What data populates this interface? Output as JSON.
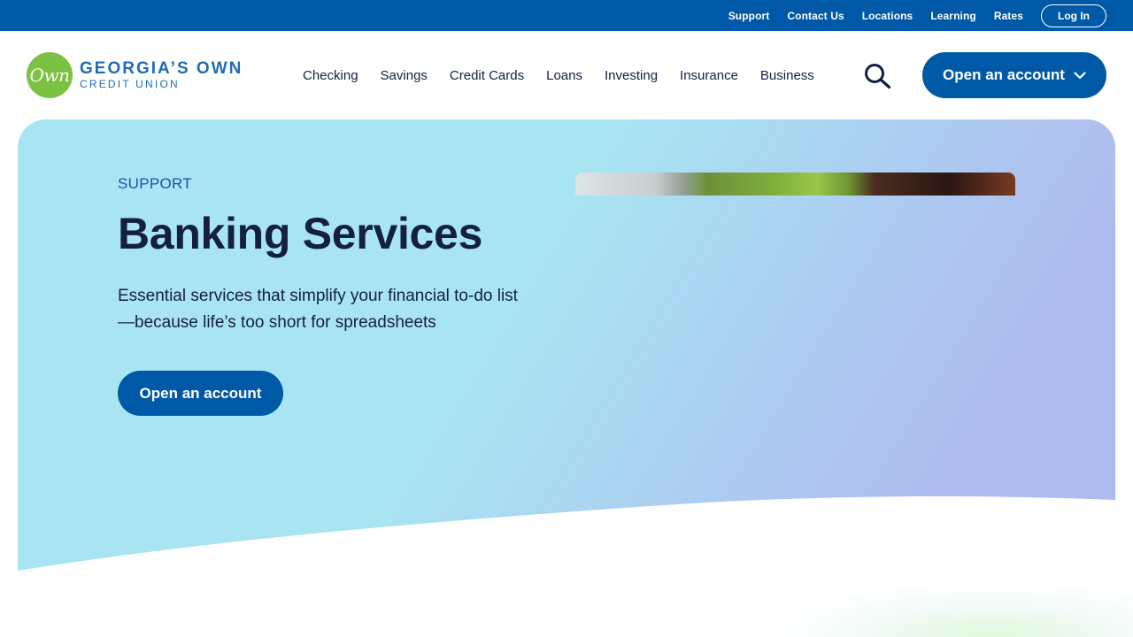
{
  "utility_nav": {
    "links": [
      "Support",
      "Contact Us",
      "Locations",
      "Learning",
      "Rates"
    ],
    "login_label": "Log In"
  },
  "logo": {
    "script": "Own",
    "line1": "GEORGIA’S OWN",
    "line2": "CREDIT UNION"
  },
  "main_nav": {
    "items": [
      "Checking",
      "Savings",
      "Credit Cards",
      "Loans",
      "Investing",
      "Insurance",
      "Business"
    ],
    "search_icon": "search-icon",
    "open_account_label": "Open an account",
    "open_account_icon": "chevron-down-icon"
  },
  "hero": {
    "eyebrow": "SUPPORT",
    "title": "Banking Services",
    "description": "Essential services that simplify your financial to-do list—because life’s too short for spreadsheets",
    "cta_label": "Open an account"
  },
  "colors": {
    "primary_blue": "#0059a6",
    "logo_green": "#7cc242",
    "heading_navy": "#14203f",
    "eyebrow_blue": "#1e4fb0",
    "hero_gradient_start": "#a9e4f3",
    "hero_gradient_end": "#afbaee"
  }
}
